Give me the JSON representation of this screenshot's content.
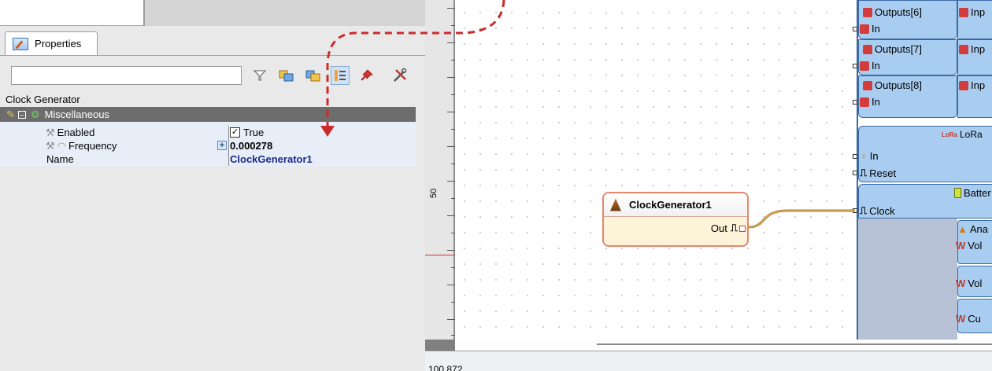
{
  "properties_panel": {
    "tab_label": "Properties",
    "object_name": "Clock Generator",
    "category": "Miscellaneous",
    "rows": [
      {
        "label": "Enabled",
        "value": "True",
        "checked": true
      },
      {
        "label": "Frequency",
        "value": "0.000278"
      },
      {
        "label": "Name",
        "value": "ClockGenerator1"
      }
    ],
    "search_placeholder": ""
  },
  "canvas": {
    "ruler_label": "50",
    "status_text": "100,872",
    "node": {
      "title": "ClockGenerator1",
      "pin_label": "Out"
    },
    "component": {
      "outputs": [
        "Outputs[6]",
        "Outputs[7]",
        "Outputs[8]"
      ],
      "inputs": [
        "Inp",
        "Inp",
        "Inp"
      ],
      "in_label": "In",
      "lora_label": "LoRa",
      "reset_label": "Reset",
      "battery_label": "Batter",
      "clock_label": "Clock",
      "sub_items": [
        "Ana",
        "Vol",
        "Vol",
        "Cu"
      ]
    }
  },
  "colors": {
    "accent_red": "#cc2b2b",
    "node_border": "#e5866d",
    "wire": "#b07a2a",
    "component_blue": "#a9cdf0"
  }
}
